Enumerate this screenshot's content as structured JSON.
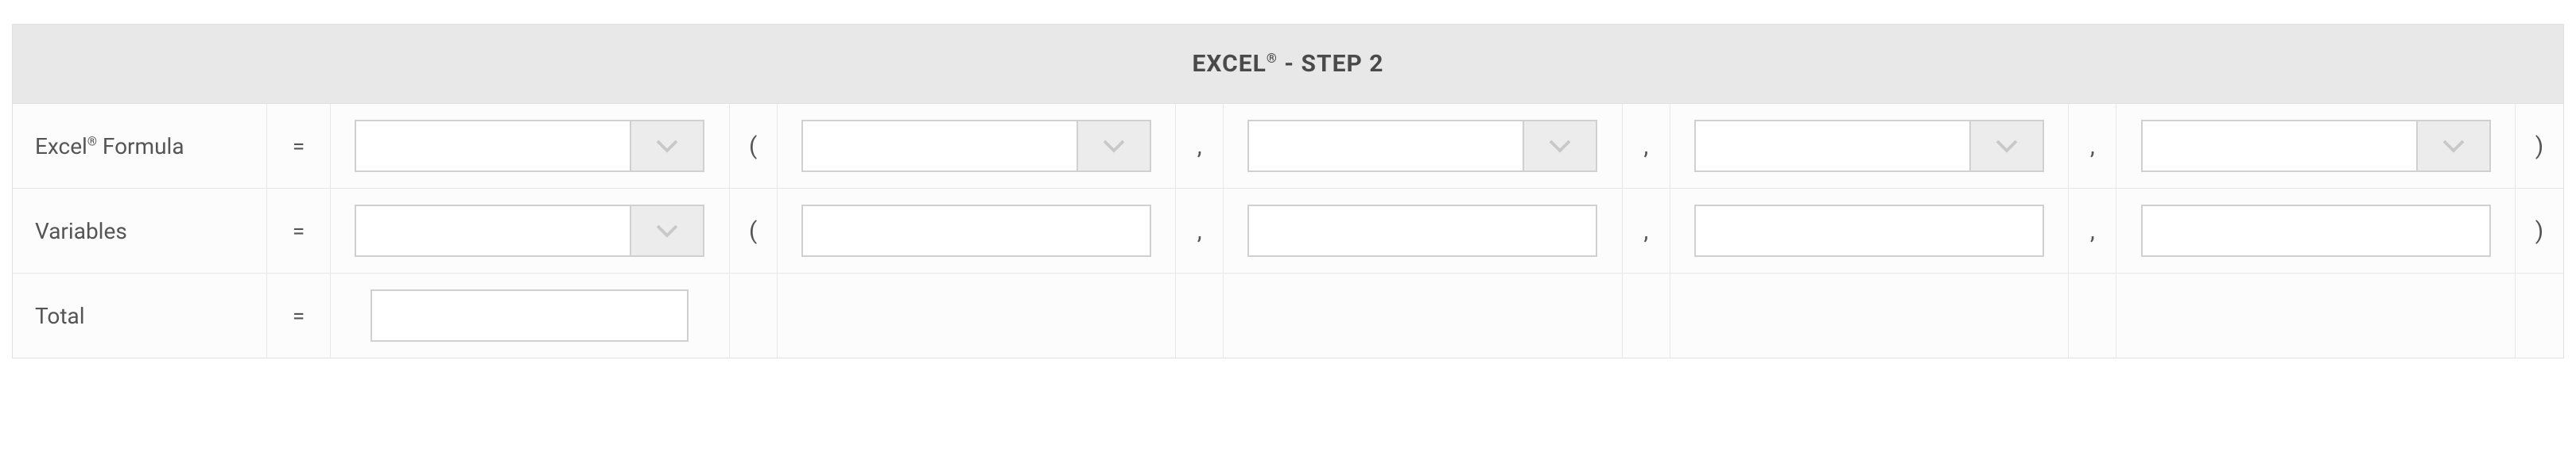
{
  "header": {
    "title_prefix": "EXCEL",
    "title_suffix": " - STEP 2"
  },
  "rows": {
    "formula": {
      "label_prefix": "Excel",
      "label_suffix": " Formula",
      "eq": "=",
      "open_paren": "(",
      "close_paren": ")",
      "comma": ",",
      "fn_value": "",
      "arg1": "",
      "arg2": "",
      "arg3": "",
      "arg4": ""
    },
    "variables": {
      "label": "Variables",
      "eq": "=",
      "open_paren": "(",
      "close_paren": ")",
      "comma": ",",
      "fn_value": "",
      "arg1": "",
      "arg2": "",
      "arg3": "",
      "arg4": ""
    },
    "total": {
      "label": "Total",
      "eq": "=",
      "value": ""
    }
  }
}
